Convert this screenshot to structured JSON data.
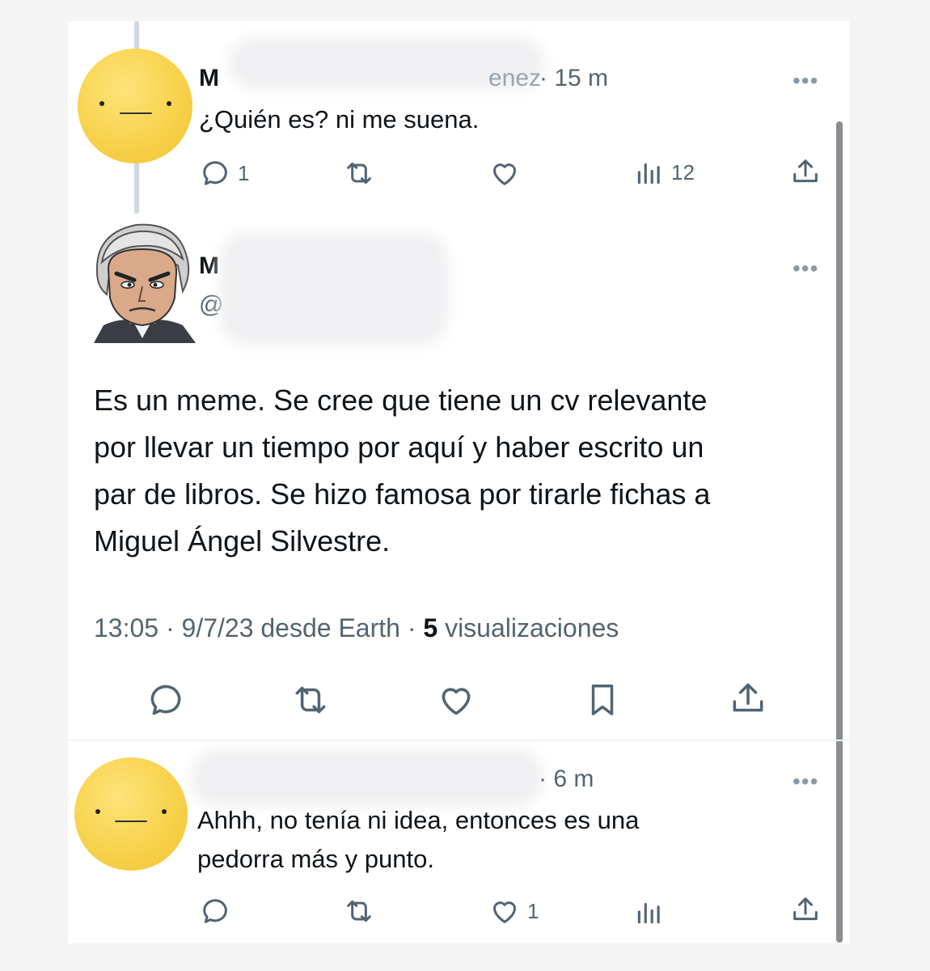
{
  "reply1": {
    "name_visible": "M",
    "name_tail": "enez",
    "time": "· 15 m",
    "text": "¿Quién es? ni me suena.",
    "more": "•••",
    "replies": "1",
    "views": "12"
  },
  "main": {
    "name_visible": "M",
    "handle_visible": "@",
    "more": "•••",
    "text_lines": [
      "Es un meme. Se cree que tiene un cv relevante",
      "por llevar un tiempo por aquí y haber escrito un",
      "par de libros. Se hizo famosa por tirarle fichas a",
      "Miguel Ángel Silvestre."
    ],
    "time": "13:05 · 9/7/23 desde Earth · ",
    "views_count": "5",
    "views_label": " visualizaciones"
  },
  "reply2": {
    "time": "· 6 m",
    "more": "•••",
    "text_lines": [
      "Ahhh, no tenía ni idea, entonces es una",
      "pedorra más y punto."
    ],
    "likes": "1"
  },
  "colors": {
    "text": "#0f1419",
    "muted": "#536471",
    "avatar": "#f8d24c"
  },
  "icons": [
    "reply-icon",
    "retweet-icon",
    "like-icon",
    "views-icon",
    "share-icon",
    "bookmark-icon",
    "more-icon"
  ]
}
